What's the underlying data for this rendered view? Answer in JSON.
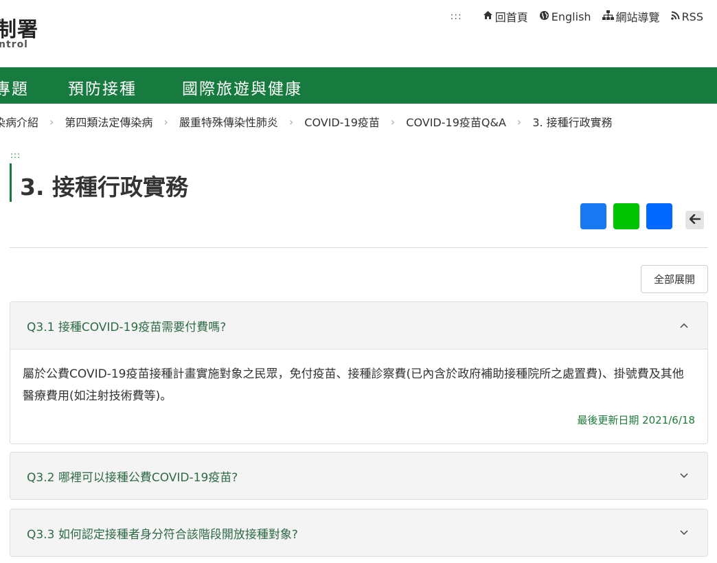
{
  "header": {
    "logo_main": "制署",
    "logo_sub": "ntrol",
    "access_key": ":::",
    "links": [
      {
        "icon": "home-icon",
        "label": "回首頁"
      },
      {
        "icon": "globe-icon",
        "label": "English"
      },
      {
        "icon": "sitemap-icon",
        "label": "網站導覽"
      },
      {
        "icon": "rss-icon",
        "label": "RSS"
      }
    ]
  },
  "nav": {
    "items": [
      "專題",
      "預防接種",
      "國際旅遊與健康"
    ]
  },
  "breadcrumb": [
    "染病介紹",
    "第四類法定傳染病",
    "嚴重特殊傳染性肺炎",
    "COVID-19疫苗",
    "COVID-19疫苗Q&A",
    "3. 接種行政實務"
  ],
  "page": {
    "access_key": ":::",
    "title": "3. 接種行政實務",
    "expand_all": "全部展開"
  },
  "colors": {
    "nav_bg": "#177a3e",
    "question_text": "#2e6a45",
    "facebook": "#1877f2",
    "line": "#00c300",
    "share_other": "#0067ff"
  },
  "faq": [
    {
      "question": "Q3.1 接種COVID-19疫苗需要付費嗎?",
      "expanded": true,
      "answer": "屬於公費COVID-19疫苗接種計畫實施對象之民眾，免付疫苗、接種診察費(已內含於政府補助接種院所之處置費)、掛號費及其他醫療費用(如注射技術費等)。",
      "updated": "最後更新日期 2021/6/18"
    },
    {
      "question": "Q3.2 哪裡可以接種公費COVID-19疫苗?",
      "expanded": false
    },
    {
      "question": "Q3.3 如何認定接種者身分符合該階段開放接種對象?",
      "expanded": false
    }
  ]
}
